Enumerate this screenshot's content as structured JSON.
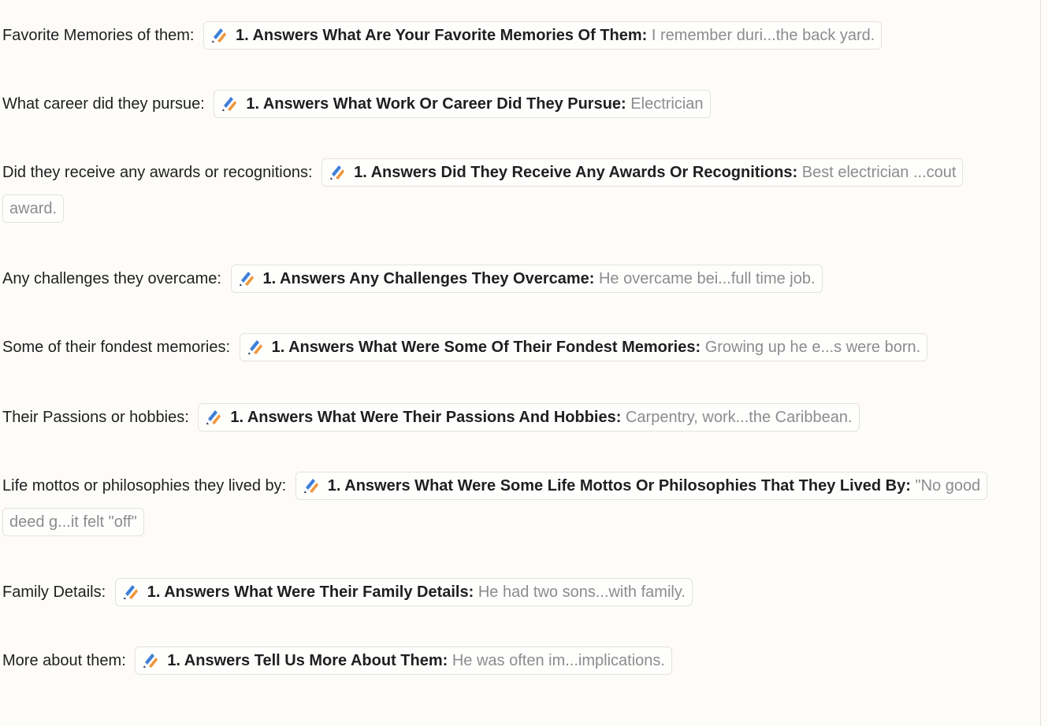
{
  "fields": [
    {
      "label": "Favorite Memories of them:",
      "key": "1. Answers What Are Your Favorite Memories Of Them:",
      "value": "I remember duri...the back yard."
    },
    {
      "label": "What career did they pursue:",
      "key": "1. Answers What Work Or Career Did They Pursue:",
      "value": "Electrician"
    },
    {
      "label": "Did they receive any awards or recognitions:",
      "key": "1. Answers Did They Receive Any Awards Or Recognitions:",
      "value": "Best electrician ...cout award."
    },
    {
      "label": "Any challenges they overcame:",
      "key": "1. Answers Any Challenges They Overcame:",
      "value": "He overcame bei...full time job."
    },
    {
      "label": "Some of their fondest memories:",
      "key": "1. Answers What Were Some Of Their Fondest Memories:",
      "value": "Growing up he e...s were born."
    },
    {
      "label": "Their Passions or hobbies:",
      "key": "1. Answers What Were Their Passions And Hobbies:",
      "value": "Carpentry, work...the Caribbean."
    },
    {
      "label": "Life mottos or philosophies they lived by:",
      "key": "1. Answers What Were Some Life Mottos Or Philosophies That They Lived By:",
      "value": "\"No good deed g...it felt \"off\""
    },
    {
      "label": "Family Details:",
      "key": "1. Answers What Were Their Family Details:",
      "value": "He had two sons...with family."
    },
    {
      "label": "More about them:",
      "key": "1. Answers Tell Us More About Them:",
      "value": "He was often im...implications."
    }
  ],
  "icon": "app-step-icon",
  "colors": {
    "icon_blue": "#3f7fd9",
    "icon_orange": "#f0953a",
    "muted_text": "#8c8c8c"
  }
}
